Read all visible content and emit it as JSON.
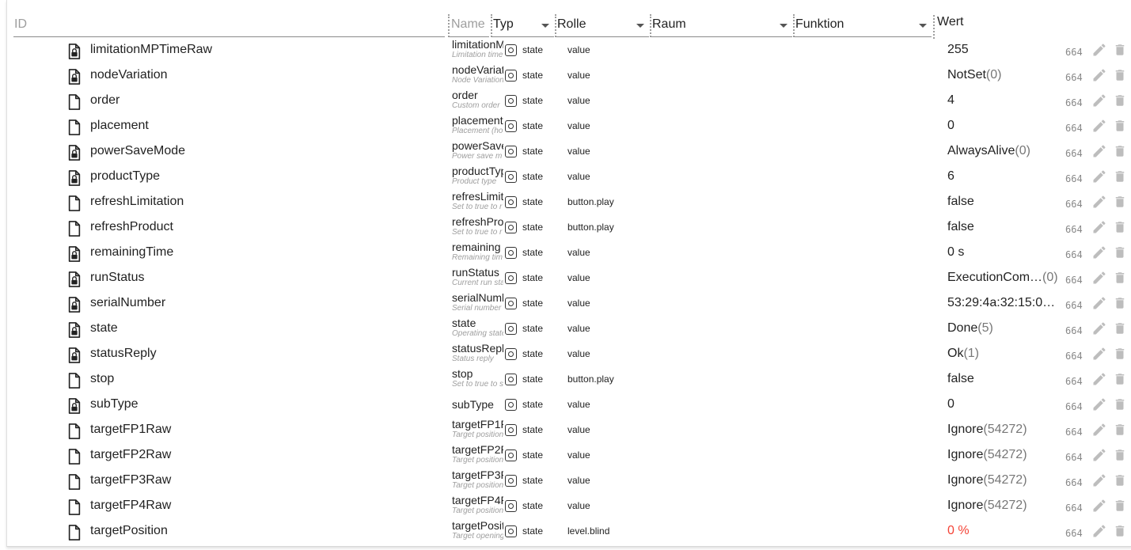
{
  "header": {
    "id_placeholder": "ID",
    "name_placeholder": "Name",
    "typ_label": "Typ",
    "rolle_label": "Rolle",
    "raum_label": "Raum",
    "funktion_label": "Funktion",
    "wert_label": "Wert"
  },
  "rows": [
    {
      "id": "limitationMPTimeRaw",
      "name": "limitationM",
      "desc": "Limitation time",
      "type": "state",
      "role": "value",
      "value": "255",
      "sub": "",
      "perm": "664",
      "locked": true
    },
    {
      "id": "nodeVariation",
      "name": "nodeVariati",
      "desc": "Node Variation",
      "type": "state",
      "role": "value",
      "value": "NotSet",
      "sub": "(0)",
      "perm": "664",
      "locked": true
    },
    {
      "id": "order",
      "name": "order",
      "desc": "Custom order",
      "type": "state",
      "role": "value",
      "value": "4",
      "sub": "",
      "perm": "664",
      "locked": false
    },
    {
      "id": "placement",
      "name": "placement",
      "desc": "Placement (ho",
      "type": "state",
      "role": "value",
      "value": "0",
      "sub": "",
      "perm": "664",
      "locked": false
    },
    {
      "id": "powerSaveMode",
      "name": "powerSave",
      "desc": "Power save m",
      "type": "state",
      "role": "value",
      "value": "AlwaysAlive",
      "sub": "(0)",
      "perm": "664",
      "locked": true
    },
    {
      "id": "productType",
      "name": "productTyp",
      "desc": "Product type",
      "type": "state",
      "role": "value",
      "value": "6",
      "sub": "",
      "perm": "664",
      "locked": true
    },
    {
      "id": "refreshLimitation",
      "name": "refresLimit",
      "desc": "Set to true to r",
      "type": "state",
      "role": "button.play",
      "value": "false",
      "sub": "",
      "perm": "664",
      "locked": false
    },
    {
      "id": "refreshProduct",
      "name": "refreshPro",
      "desc": "Set to true to r",
      "type": "state",
      "role": "button.play",
      "value": "false",
      "sub": "",
      "perm": "664",
      "locked": false
    },
    {
      "id": "remainingTime",
      "name": "remaining",
      "desc": "Remaining tim",
      "type": "state",
      "role": "value",
      "value": "0 s",
      "sub": "",
      "perm": "664",
      "locked": true
    },
    {
      "id": "runStatus",
      "name": "runStatus",
      "desc": "Current run sta",
      "type": "state",
      "role": "value",
      "value": "ExecutionCom…",
      "sub": "(0)",
      "perm": "664",
      "locked": true
    },
    {
      "id": "serialNumber",
      "name": "serialNumb",
      "desc": "Serial number",
      "type": "state",
      "role": "value",
      "value": "53:29:4a:32:15:0…",
      "sub": "",
      "perm": "664",
      "locked": true
    },
    {
      "id": "state",
      "name": "state",
      "desc": "Operating state",
      "type": "state",
      "role": "value",
      "value": "Done",
      "sub": "(5)",
      "perm": "664",
      "locked": true
    },
    {
      "id": "statusReply",
      "name": "statusRepl",
      "desc": "Status reply",
      "type": "state",
      "role": "value",
      "value": "Ok",
      "sub": "(1)",
      "perm": "664",
      "locked": true
    },
    {
      "id": "stop",
      "name": "stop",
      "desc": "Set to true to s",
      "type": "state",
      "role": "button.play",
      "value": "false",
      "sub": "",
      "perm": "664",
      "locked": false
    },
    {
      "id": "subType",
      "name": "subType",
      "desc": "",
      "type": "state",
      "role": "value",
      "value": "0",
      "sub": "",
      "perm": "664",
      "locked": true
    },
    {
      "id": "targetFP1Raw",
      "name": "targetFP1R",
      "desc": "Target position",
      "type": "state",
      "role": "value",
      "value": "Ignore",
      "sub": "(54272)",
      "perm": "664",
      "locked": false
    },
    {
      "id": "targetFP2Raw",
      "name": "targetFP2R",
      "desc": "Target position",
      "type": "state",
      "role": "value",
      "value": "Ignore",
      "sub": "(54272)",
      "perm": "664",
      "locked": false
    },
    {
      "id": "targetFP3Raw",
      "name": "targetFP3R",
      "desc": "Target position",
      "type": "state",
      "role": "value",
      "value": "Ignore",
      "sub": "(54272)",
      "perm": "664",
      "locked": false
    },
    {
      "id": "targetFP4Raw",
      "name": "targetFP4R",
      "desc": "Target position",
      "type": "state",
      "role": "value",
      "value": "Ignore",
      "sub": "(54272)",
      "perm": "664",
      "locked": false
    },
    {
      "id": "targetPosition",
      "name": "targetPositi",
      "desc": "Target opening",
      "type": "state",
      "role": "level.blind",
      "value": "0 %",
      "sub": "",
      "perm": "664",
      "locked": false,
      "alert": true
    }
  ],
  "colors": {
    "alert": "#f44336",
    "muted": "#9e9e9e"
  },
  "icons": {
    "file": "file-icon",
    "locked_file": "locked-file-icon",
    "type": "state-type-icon",
    "edit": "edit-icon",
    "delete": "delete-icon"
  }
}
